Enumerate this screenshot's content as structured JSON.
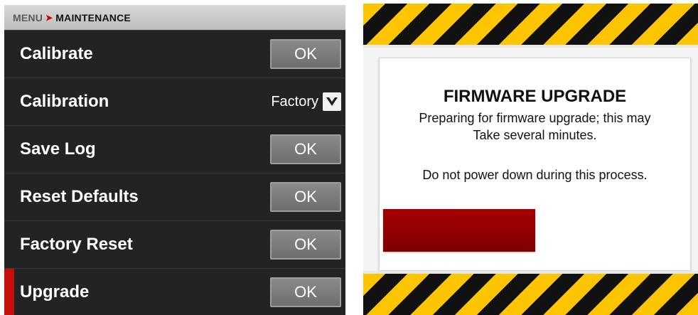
{
  "breadcrumb": {
    "root": "MENU",
    "separator": "➤",
    "current": "MAINTENANCE"
  },
  "menu": {
    "rows": [
      {
        "label": "Calibrate",
        "control": "button",
        "button_label": "OK"
      },
      {
        "label": "Calibration",
        "control": "dropdown",
        "selected_value": "Factory"
      },
      {
        "label": "Save Log",
        "control": "button",
        "button_label": "OK"
      },
      {
        "label": "Reset Defaults",
        "control": "button",
        "button_label": "OK"
      },
      {
        "label": "Factory Reset",
        "control": "button",
        "button_label": "OK"
      },
      {
        "label": "Upgrade",
        "control": "button",
        "button_label": "OK",
        "selected": true
      }
    ]
  },
  "firmware_dialog": {
    "title": "FIRMWARE UPGRADE",
    "message_line1": "Preparing for firmware upgrade; this may",
    "message_line2": "Take several minutes.",
    "warning": "Do not power down during this process.",
    "progress_fraction": 0.5
  },
  "colors": {
    "accent_red": "#c40f0f",
    "progress_red": "#8f0000",
    "hazard_yellow": "#fdc400",
    "hazard_black": "#111111",
    "menu_background": "#232323"
  },
  "icons": {
    "breadcrumb_separator": "chevron-right-icon",
    "dropdown": "chevron-down-icon"
  }
}
